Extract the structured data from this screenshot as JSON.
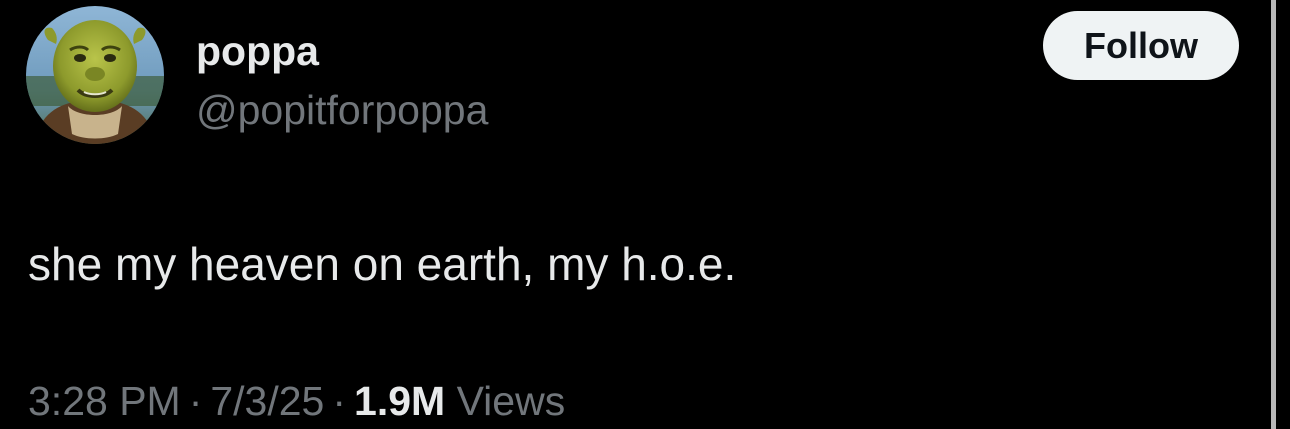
{
  "author": {
    "display_name": "poppa",
    "handle": "@popitforpoppa",
    "avatar_icon": "user-avatar"
  },
  "follow_button": {
    "label": "Follow"
  },
  "tweet": {
    "text": "she my heaven on earth, my h.o.e."
  },
  "meta": {
    "time": "3:28 PM",
    "separator": "·",
    "date": "7/3/25",
    "views_count": "1.9M",
    "views_label": "Views"
  },
  "colors": {
    "background": "#000000",
    "primary_text": "#e7e9ea",
    "secondary_text": "#71767b",
    "button_bg": "#eff3f4",
    "button_text": "#0f1419"
  }
}
